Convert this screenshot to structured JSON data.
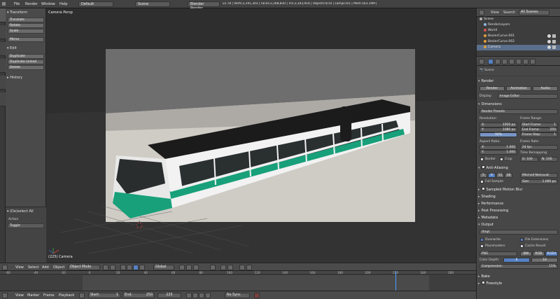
{
  "topbar": {
    "menus": [
      "File",
      "Render",
      "Window",
      "Help"
    ],
    "layout": "Default",
    "scene": "Scene",
    "engine": "Blender Render",
    "stats": "v2.78 | Verts:2,291,303 | Faces:2,268,830 | Tris:2,343,916 | Objects:0/10 | Lamps:0/1 | Mem:163.19M | Camera"
  },
  "toolshelf": {
    "tabs": [
      "Tools",
      "Create",
      "Relations",
      "Animation",
      "Physics",
      "Grease Pencil"
    ],
    "transform_header": "Transform",
    "transform_buttons": [
      "Translate",
      "Rotate",
      "Scale"
    ],
    "mirror": "Mirror",
    "edit_header": "Edit",
    "edit_buttons": [
      "Duplicate",
      "Duplicate Linked",
      "Delete"
    ],
    "history_header": "History",
    "operator_header": "(De)select All",
    "action_label": "Action",
    "action_value": "Toggle"
  },
  "viewport": {
    "label": "Camera Persp",
    "frame_label": "(225) Camera"
  },
  "vpheader": {
    "menus": [
      "View",
      "Select",
      "Add",
      "Object"
    ],
    "mode": "Object Mode",
    "orientation": "Global"
  },
  "timeline": {
    "ticks": [
      "-60",
      "-40",
      "-20",
      "0",
      "20",
      "40",
      "60",
      "80",
      "100",
      "120",
      "140",
      "160",
      "180",
      "200",
      "220",
      "240",
      "260"
    ],
    "menus": [
      "View",
      "Marker",
      "Frame",
      "Playback"
    ],
    "start": "Start:",
    "start_val": "1",
    "end": "End:",
    "end_val": "250",
    "current": "225",
    "sync": "No Sync"
  },
  "outliner": {
    "header_menus": [
      "View",
      "Search"
    ],
    "scenes": "All Scenes",
    "rows": [
      {
        "label": "Scene",
        "color": "#b5b5b5"
      },
      {
        "label": "RenderLayers",
        "color": "#8fb6e0"
      },
      {
        "label": "World",
        "color": "#d9534f"
      },
      {
        "label": "BezierCurve.001",
        "color": "#e09e3e"
      },
      {
        "label": "BezierCurve.002",
        "color": "#e09e3e"
      },
      {
        "label": "Camera",
        "color": "#e09e3e"
      }
    ]
  },
  "props": {
    "context": "Scene",
    "render_header": "Render",
    "render_buttons": [
      "Render",
      "Animation",
      "Audio"
    ],
    "display_label": "Display:",
    "display_value": "Image Editor",
    "dimensions_header": "Dimensions",
    "presets": "Render Presets",
    "resolution": "Resolution:",
    "res_x": "1920 px",
    "res_y": "1080 px",
    "res_pct": "50%",
    "frame_range": "Frame Range:",
    "start_frame": "1",
    "end_frame": "250",
    "frame_step": "1",
    "aspect_ratio": "Aspect Ratio:",
    "asp_x": "1.000",
    "asp_y": "1.000",
    "frame_rate": "Frame Rate:",
    "fps": "24 fps",
    "time_remap": "Time Remapping:",
    "old": "O: 100",
    "new": "N: 100",
    "border": "Border",
    "crop": "Crop",
    "aa_header": "Anti-Aliasing",
    "aa_levels": [
      "5",
      "8",
      "11",
      "16"
    ],
    "aa_filter": "Mitchell-Netravali",
    "full_sample": "Full Sample",
    "size": "Size:",
    "size_val": "1.000 px",
    "collapsed": [
      "Sampled Motion Blur",
      "Shading",
      "Performance",
      "Post Processing",
      "Metadata"
    ],
    "output_header": "Output",
    "output_path": "/tmp\\",
    "overwrite": "Overwrite",
    "file_ext": "File Extensions",
    "placeholders": "Placeholders",
    "cache": "Cache Result",
    "format": "PNG",
    "bw": "BW",
    "rgb": "RGB",
    "rgba": "RGBA",
    "color_depth": "Color Depth:",
    "depth8": "8",
    "depth16": "16",
    "compression": "Compression:",
    "comp_val": "15%",
    "bake": "Bake",
    "freestyle": "Freestyle"
  }
}
